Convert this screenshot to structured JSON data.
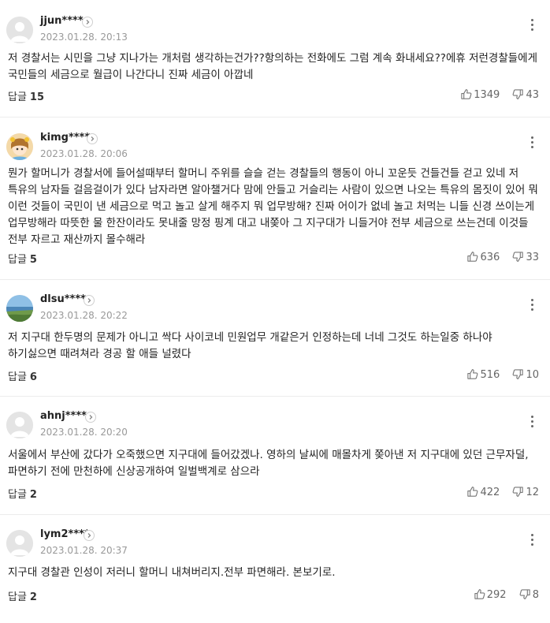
{
  "comments": [
    {
      "user": "jjun****",
      "date": "2023.01.28. 20:13",
      "text": "저 경찰서는 시민을 그냥 지나가는 개처럼 생각하는건가??항의하는 전화에도 그럼 계속 화내세요??에휴 저런경찰들에게 국민들의 세금으로 월급이 나간다니 진짜 세금이 아깝네",
      "reply_label": "답글",
      "reply_count": "15",
      "likes": "1349",
      "dislikes": "43",
      "avatar": "default-avatar-icon"
    },
    {
      "user": "kimg****",
      "date": "2023.01.28. 20:06",
      "text": "뭔가 할머니가 경찰서에 들어설때부터 할머니 주위를 슬슬 걷는 경찰들의 행동이 아니 꼬운듯 건들건들 걷고 있네 저 특유의 남자들 걸음걸이가 있다 남자라면 알아챌거다 맘에 안들고 거슬리는 사람이 있으면 나오는 특유의 몸짓이 있어 뭐 이런 것들이 국민이 낸 세금으로 먹고 놀고 살게 해주지 뭐 업무방해? 진짜 어이가 없네 놀고 처먹는 니들 신경 쓰이는게 업무방해라 따뜻한 물 한잔이라도 못내줄 망정 핑계 대고 내쫒아 그 지구대가 니들거야 전부 세금으로 쓰는건데 이것들 전부 자르고 재산까지 몰수해라",
      "reply_label": "답글",
      "reply_count": "5",
      "likes": "636",
      "dislikes": "33",
      "avatar": "character-avatar-icon"
    },
    {
      "user": "dlsu****",
      "date": "2023.01.28. 20:22",
      "text": "저 지구대 한두명의 문제가 아니고 싹다 사이코네 민원업무 개같은거 인정하는데 너네 그것도 하는일중 하나야 하기싫으면 때려쳐라 경공 할 애들 널렸다",
      "reply_label": "답글",
      "reply_count": "6",
      "likes": "516",
      "dislikes": "10",
      "avatar": "landscape-avatar-icon"
    },
    {
      "user": "ahnj****",
      "date": "2023.01.28. 20:20",
      "text": "서울에서 부산에 갔다가 오죽했으면 지구대에 들어갔겠나. 영하의 날씨에 매몰차게 쫒아낸 저 지구대에 있던 근무자덜, 파면하기 전에 만천하에 신상공개하여 일벌백계로 삼으라",
      "reply_label": "답글",
      "reply_count": "2",
      "likes": "422",
      "dislikes": "12",
      "avatar": "default-avatar-icon"
    },
    {
      "user": "lym2****",
      "date": "2023.01.28. 20:37",
      "text": "지구대 경찰관 인성이 저러니 할머니 내쳐버리지.전부 파면해라. 본보기로.",
      "reply_label": "답글",
      "reply_count": "2",
      "likes": "292",
      "dislikes": "8",
      "avatar": "default-avatar-icon"
    }
  ]
}
